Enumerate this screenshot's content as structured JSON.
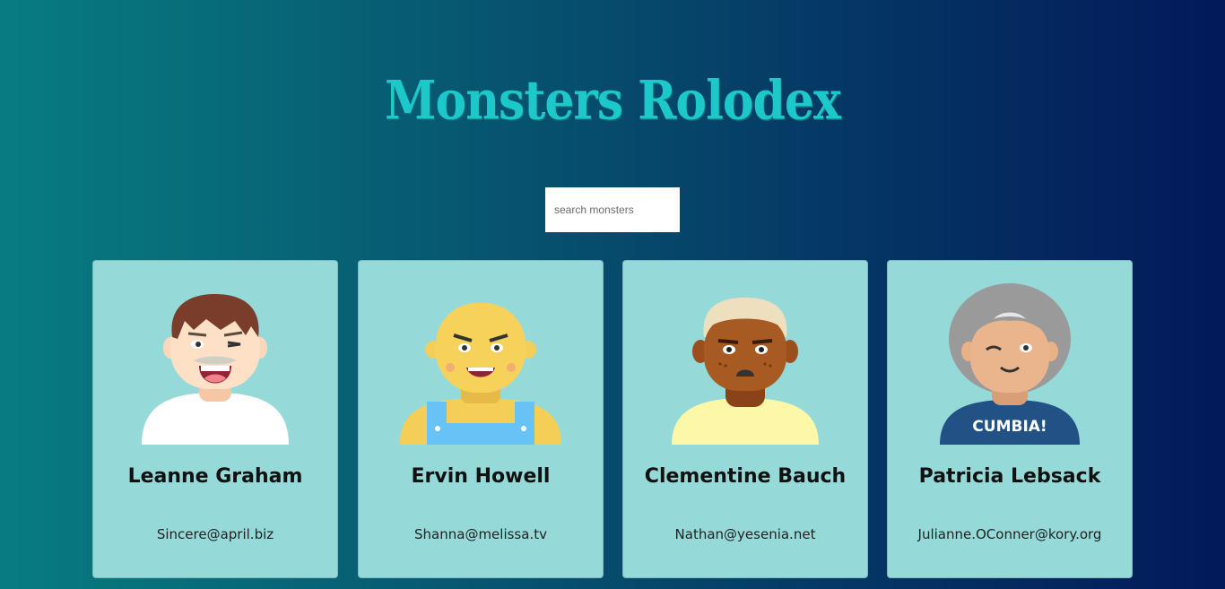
{
  "title": "Monsters Rolodex",
  "search": {
    "placeholder": "search monsters"
  },
  "monsters": [
    {
      "name": "Leanne Graham",
      "email": "Sincere@april.biz"
    },
    {
      "name": "Ervin Howell",
      "email": "Shanna@melissa.tv"
    },
    {
      "name": "Clementine Bauch",
      "email": "Nathan@yesenia.net"
    },
    {
      "name": "Patricia Lebsack",
      "email": "Julianne.OConner@kory.org",
      "shirt_text": "CUMBIA!"
    }
  ],
  "colors": {
    "title": "#1cc8c9",
    "card_background": "#96d9d9",
    "background_start": "#077c80",
    "background_end": "#03195a"
  }
}
